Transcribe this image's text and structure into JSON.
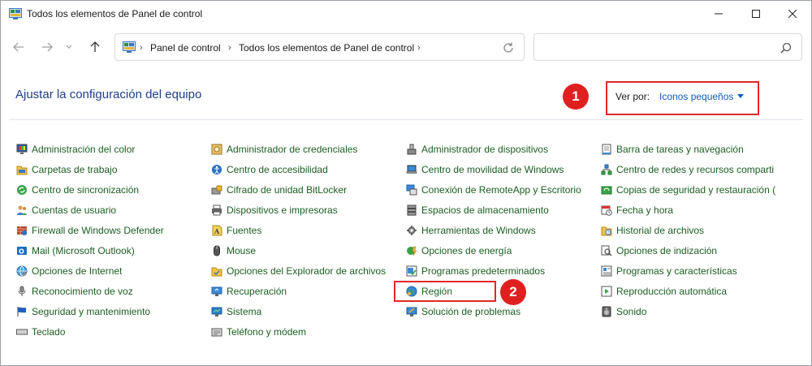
{
  "window": {
    "title": "Todos los elementos de Panel de control"
  },
  "address": {
    "crumbs": [
      "Panel de control",
      "Todos los elementos de Panel de control"
    ]
  },
  "search": {
    "placeholder": ""
  },
  "header": {
    "title": "Ajustar la configuración del equipo",
    "view_by_label": "Ver por:",
    "view_by_value": "Iconos pequeños"
  },
  "annotations": {
    "badge_1": "1",
    "badge_2": "2"
  },
  "colors": {
    "link_green": "#1b5e20",
    "title_blue": "#1e3e8c",
    "accent_blue": "#0a5fbf",
    "highlight_red": "#e0282a"
  },
  "items": {
    "col1": [
      {
        "label": "Administración del color",
        "icon": "color-management-icon"
      },
      {
        "label": "Carpetas de trabajo",
        "icon": "work-folders-icon"
      },
      {
        "label": "Centro de sincronización",
        "icon": "sync-center-icon"
      },
      {
        "label": "Cuentas de usuario",
        "icon": "user-accounts-icon"
      },
      {
        "label": "Firewall de Windows Defender",
        "icon": "firewall-icon"
      },
      {
        "label": "Mail (Microsoft Outlook)",
        "icon": "mail-icon"
      },
      {
        "label": "Opciones de Internet",
        "icon": "internet-options-icon"
      },
      {
        "label": "Reconocimiento de voz",
        "icon": "microphone-icon"
      },
      {
        "label": "Seguridad y mantenimiento",
        "icon": "flag-icon"
      },
      {
        "label": "Teclado",
        "icon": "keyboard-icon"
      }
    ],
    "col2": [
      {
        "label": "Administrador de credenciales",
        "icon": "credential-manager-icon"
      },
      {
        "label": "Centro de accesibilidad",
        "icon": "accessibility-icon"
      },
      {
        "label": "Cifrado de unidad BitLocker",
        "icon": "bitlocker-icon"
      },
      {
        "label": "Dispositivos e impresoras",
        "icon": "printer-icon"
      },
      {
        "label": "Fuentes",
        "icon": "fonts-icon"
      },
      {
        "label": "Mouse",
        "icon": "mouse-icon"
      },
      {
        "label": "Opciones del Explorador de archivos",
        "icon": "folder-options-icon"
      },
      {
        "label": "Recuperación",
        "icon": "recovery-icon"
      },
      {
        "label": "Sistema",
        "icon": "system-icon"
      },
      {
        "label": "Teléfono y módem",
        "icon": "phone-modem-icon"
      }
    ],
    "col3": [
      {
        "label": "Administrador de dispositivos",
        "icon": "device-manager-icon"
      },
      {
        "label": "Centro de movilidad de Windows",
        "icon": "mobility-center-icon"
      },
      {
        "label": "Conexión de RemoteApp y Escritorio",
        "icon": "remoteapp-icon"
      },
      {
        "label": "Espacios de almacenamiento",
        "icon": "storage-spaces-icon"
      },
      {
        "label": "Herramientas de Windows",
        "icon": "windows-tools-icon"
      },
      {
        "label": "Opciones de energía",
        "icon": "power-options-icon"
      },
      {
        "label": "Programas predeterminados",
        "icon": "default-programs-icon"
      },
      {
        "label": "Región",
        "icon": "region-globe-icon"
      },
      {
        "label": "Solución de problemas",
        "icon": "troubleshooting-icon"
      }
    ],
    "col4": [
      {
        "label": "Barra de tareas y navegación",
        "icon": "taskbar-icon"
      },
      {
        "label": "Centro de redes y recursos comparti",
        "icon": "network-center-icon"
      },
      {
        "label": "Copias de seguridad y restauración (",
        "icon": "backup-icon"
      },
      {
        "label": "Fecha y hora",
        "icon": "date-time-icon"
      },
      {
        "label": "Historial de archivos",
        "icon": "file-history-icon"
      },
      {
        "label": "Opciones de indización",
        "icon": "indexing-icon"
      },
      {
        "label": "Programas y características",
        "icon": "programs-features-icon"
      },
      {
        "label": "Reproducción automática",
        "icon": "autoplay-icon"
      },
      {
        "label": "Sonido",
        "icon": "sound-icon"
      }
    ]
  }
}
